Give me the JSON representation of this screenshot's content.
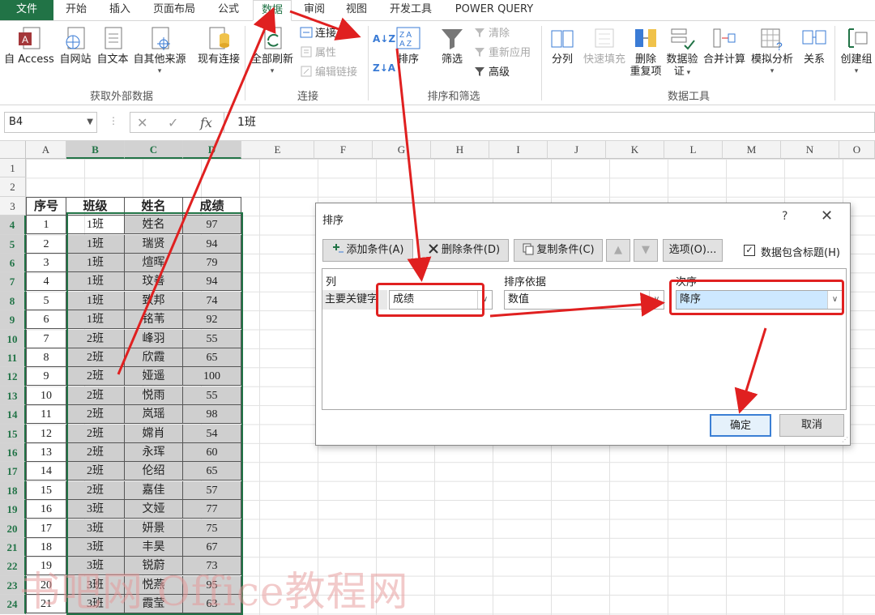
{
  "ribbon_tabs": [
    "文件",
    "开始",
    "插入",
    "页面布局",
    "公式",
    "数据",
    "审阅",
    "视图",
    "开发工具",
    "POWER QUERY"
  ],
  "active_tab": "数据",
  "ribbon": {
    "get_external": {
      "from_access": "自 Access",
      "from_web": "自网站",
      "from_text": "自文本",
      "from_other": "自其他来源",
      "existing_conn": "现有连接",
      "group_label": "获取外部数据"
    },
    "connections": {
      "refresh_all": "全部刷新",
      "connections": "连接",
      "properties": "属性",
      "edit_links": "编辑链接",
      "group_label": "连接"
    },
    "sort_filter": {
      "sort": "排序",
      "filter": "筛选",
      "clear": "清除",
      "reapply": "重新应用",
      "advanced": "高级",
      "group_label": "排序和筛选"
    },
    "data_tools": {
      "text_to_columns": "分列",
      "flash_fill": "快速填充",
      "remove_dup_1": "删除",
      "remove_dup_2": "重复项",
      "validation_1": "数据验",
      "validation_2": "证",
      "consolidate": "合并计算",
      "what_if": "模拟分析",
      "relationships": "关系",
      "group_label": "数据工具"
    },
    "outline": {
      "group": "创建组"
    }
  },
  "formula_bar": {
    "name_box": "B4",
    "cancel": "✕",
    "enter": "✓",
    "fx": "fx",
    "content": "1班"
  },
  "columns": [
    "A",
    "B",
    "C",
    "D",
    "E",
    "F",
    "G",
    "H",
    "I",
    "J",
    "K",
    "L",
    "M",
    "N",
    "O"
  ],
  "rows": [
    "1",
    "2",
    "3",
    "4",
    "5",
    "6",
    "7",
    "8",
    "9",
    "10",
    "11",
    "12",
    "13",
    "14",
    "15",
    "16",
    "17",
    "18",
    "19",
    "20",
    "21",
    "22",
    "23",
    "24"
  ],
  "table_headers": [
    "序号",
    "班级",
    "姓名",
    "成绩"
  ],
  "table_rows": [
    [
      "1",
      "1班",
      "姓名",
      "97"
    ],
    [
      "2",
      "1班",
      "瑞贤",
      "94"
    ],
    [
      "3",
      "1班",
      "煊晖",
      "79"
    ],
    [
      "4",
      "1班",
      "玟善",
      "94"
    ],
    [
      "5",
      "1班",
      "致邦",
      "74"
    ],
    [
      "6",
      "1班",
      "铭苇",
      "92"
    ],
    [
      "7",
      "2班",
      "峰羽",
      "55"
    ],
    [
      "8",
      "2班",
      "欣霞",
      "65"
    ],
    [
      "9",
      "2班",
      "娅遥",
      "100"
    ],
    [
      "10",
      "2班",
      "悦雨",
      "55"
    ],
    [
      "11",
      "2班",
      "岚瑶",
      "98"
    ],
    [
      "12",
      "2班",
      "嫦肖",
      "54"
    ],
    [
      "13",
      "2班",
      "永珲",
      "60"
    ],
    [
      "14",
      "2班",
      "伦绍",
      "65"
    ],
    [
      "15",
      "2班",
      "嘉佳",
      "57"
    ],
    [
      "16",
      "3班",
      "文娅",
      "77"
    ],
    [
      "17",
      "3班",
      "妍景",
      "75"
    ],
    [
      "18",
      "3班",
      "丰昊",
      "67"
    ],
    [
      "19",
      "3班",
      "锐蔚",
      "73"
    ],
    [
      "20",
      "3班",
      "悦燕",
      "95"
    ],
    [
      "21",
      "3班",
      "霞莹",
      "63"
    ]
  ],
  "dialog": {
    "title": "排序",
    "help": "?",
    "close": "✕",
    "add_level": "添加条件(A)",
    "delete_level": "删除条件(D)",
    "copy_level": "复制条件(C)",
    "up": "▲",
    "down": "▼",
    "options": "选项(O)...",
    "has_headers": "数据包含标题(H)",
    "has_headers_checked": "✓",
    "col_header": "列",
    "sort_on_header": "排序依据",
    "order_header": "次序",
    "primary_key": "主要关键字",
    "column_value": "成绩",
    "sort_on_value": "数值",
    "order_value": "降序",
    "ok": "确定",
    "cancel": "取消"
  },
  "watermark": "书吧网 Office教程网",
  "colors": {
    "excel_green": "#217346",
    "annotation_red": "#e02020",
    "selection_fill": "#cfcfcf"
  }
}
